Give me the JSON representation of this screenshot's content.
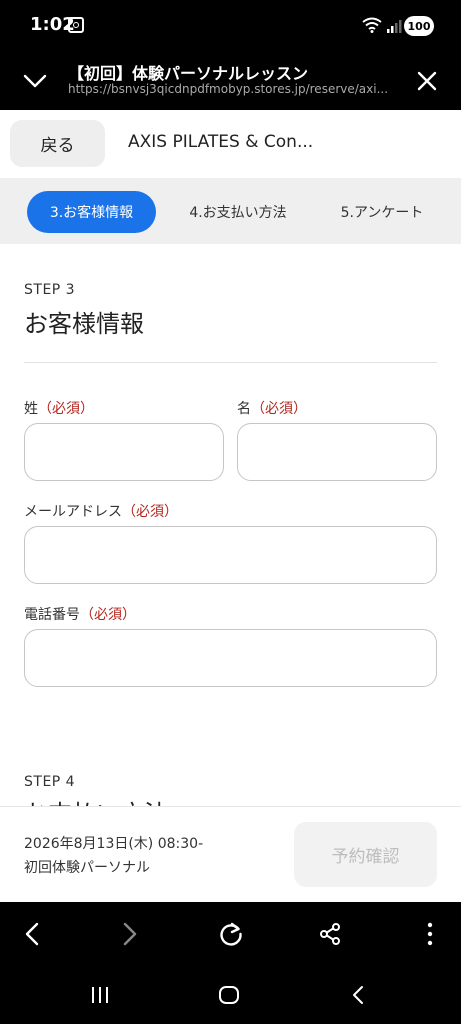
{
  "status_bar": {
    "time": "1:02",
    "battery": "100"
  },
  "browser": {
    "title": "【初回】体験パーソナルレッスン",
    "url": "https://bsnvsj3qicdnpdfmobyp.stores.jp/reserve/axi..."
  },
  "store_header": {
    "back_label": "戻る",
    "store_name": "AXIS PILATES & Con..."
  },
  "steps": [
    {
      "label": "3.お客様情報",
      "active": true
    },
    {
      "label": "4.お支払い方法",
      "active": false
    },
    {
      "label": "5.アンケート",
      "active": false
    }
  ],
  "form": {
    "step_label": "STEP 3",
    "section_title": "お客様情報",
    "required_tag": "（必須）",
    "fields": {
      "last_name": {
        "label": "姓",
        "value": ""
      },
      "first_name": {
        "label": "名",
        "value": ""
      },
      "email": {
        "label": "メールアドレス",
        "value": ""
      },
      "phone": {
        "label": "電話番号",
        "value": ""
      }
    }
  },
  "next_section": {
    "step_label": "STEP 4",
    "title": "お支払い方法"
  },
  "footer": {
    "datetime": "2026年8月13日(木) 08:30-",
    "plan": "初回体験パーソナル",
    "confirm_label": "予約確認"
  },
  "colors": {
    "accent": "#1a73e8",
    "required": "#b3261e",
    "disabled_text": "#bdbdbd"
  },
  "icons": {
    "browser": [
      "chevron-down-icon",
      "close-icon"
    ],
    "toolbar": [
      "back-icon",
      "forward-icon",
      "reload-icon",
      "share-icon",
      "more-icon"
    ],
    "navbar": [
      "recents-icon",
      "home-icon",
      "nav-back-icon"
    ]
  }
}
